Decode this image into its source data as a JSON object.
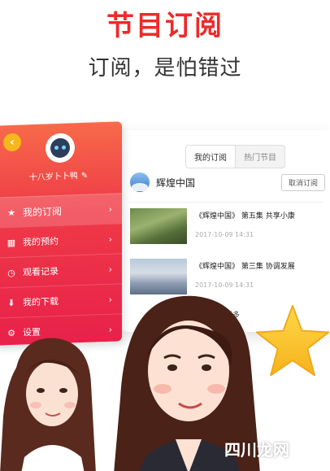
{
  "colors": {
    "accent": "#ee2a2a",
    "sidebar_top": "#f76a4a",
    "sidebar_bottom": "#e8214b",
    "star": "#f9c52b"
  },
  "header": {
    "title": "节目订阅",
    "subtitle": "订阅，是怕错过"
  },
  "sidebar": {
    "back_icon": "chevron-left-icon",
    "username": "十八岁卜卜鸭",
    "items": [
      {
        "label": "我的订阅",
        "icon": "star-icon",
        "active": true
      },
      {
        "label": "我的预约",
        "icon": "calendar-icon",
        "active": false
      },
      {
        "label": "观看记录",
        "icon": "clock-icon",
        "active": false
      },
      {
        "label": "我的下载",
        "icon": "download-icon",
        "active": false
      },
      {
        "label": "设置",
        "icon": "gear-icon",
        "active": false
      }
    ]
  },
  "content": {
    "tabs": [
      {
        "label": "我的订阅"
      },
      {
        "label": "热门节目"
      }
    ],
    "channel": {
      "name": "辉煌中国",
      "action": "取消订阅"
    },
    "episodes": [
      {
        "title": "《辉煌中国》 第五集 共享小康",
        "time": "2017-10-09 14:31"
      },
      {
        "title": "《辉煌中国》 第三集 协调发展",
        "time": "2017-10-09 14:31"
      }
    ],
    "show_more": "显示更多"
  },
  "watermark": "四川龙网"
}
